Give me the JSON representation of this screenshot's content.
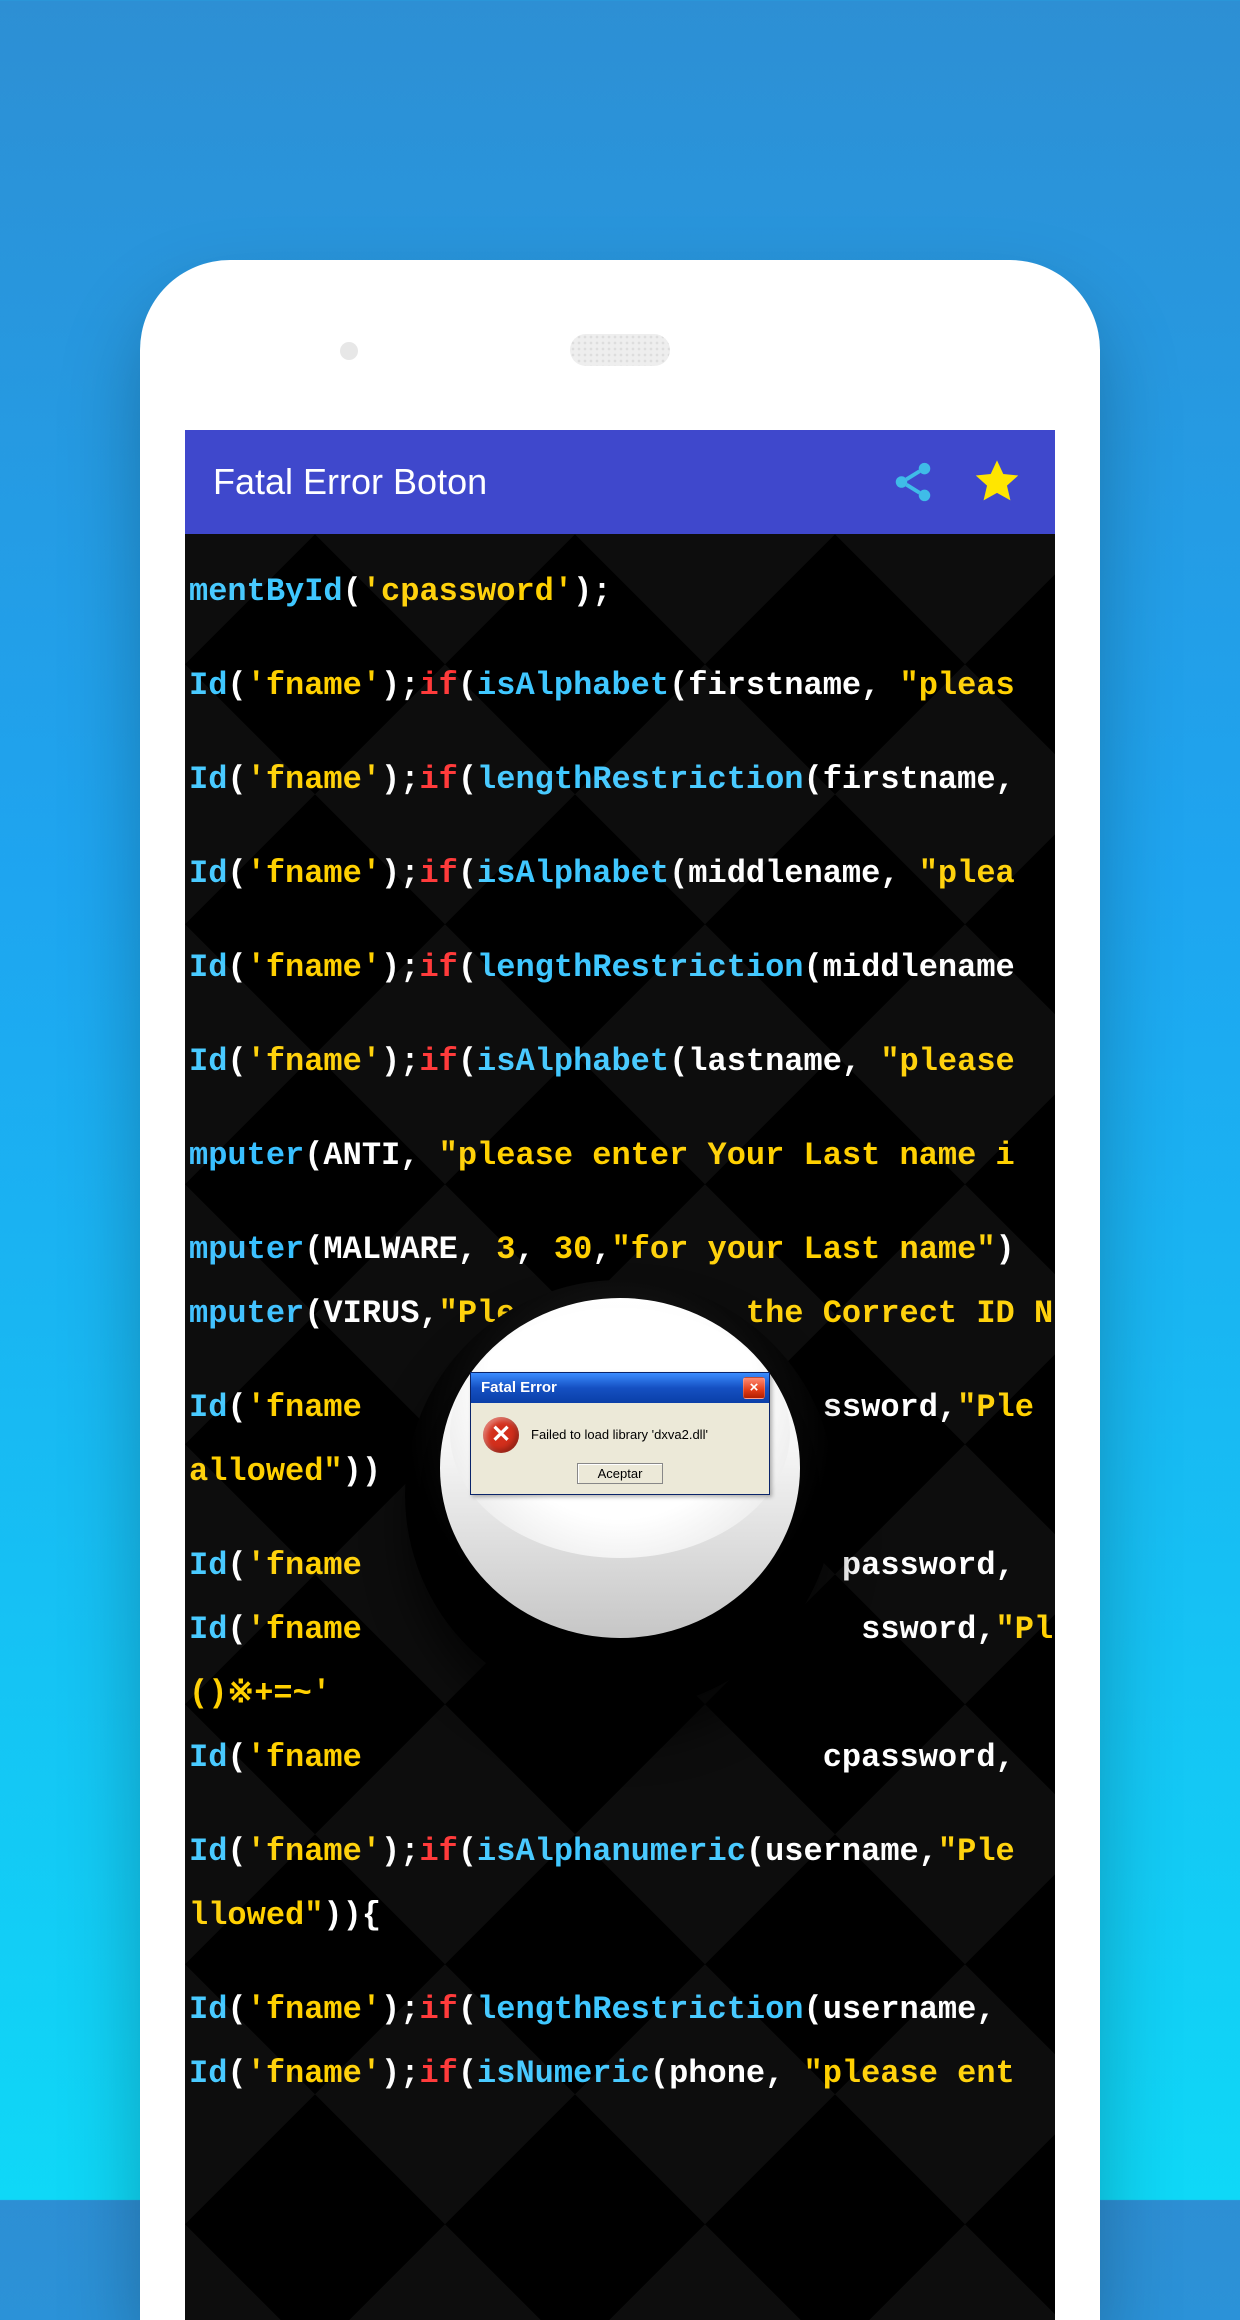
{
  "titlebar": {
    "title": "Fatal Error Boton"
  },
  "dialog": {
    "caption": "Fatal Error",
    "message": "Failed to load library 'dxva2.dll'",
    "accept": "Aceptar"
  },
  "icons": {
    "share": "share-icon",
    "star": "favorite-star-icon",
    "close": "close-icon",
    "error": "error-circle-icon"
  },
  "code_lines": [
    "mentById('cpassword');",
    "Id('fname');if(isAlphabet(firstname, \"pleas",
    "Id('fname');if(lengthRestriction(firstname,",
    "Id('fname');if(isAlphabet(middlename, \"plea",
    "Id('fname');if(lengthRestriction(middlename",
    "Id('fname');if(isAlphabet(lastname, \"please",
    "mputer(ANTI, \"please enter Your Last name i",
    "mputer(MALWARE, 3, 30,\"for your Last name\")",
    "mputer(VIRUS,\"Plea        the Correct ID N",
    "Id('fname                        ssword,\"Ple",
    "allowed\"))",
    "Id('fname                         password,",
    "Id('fname                          ssword,\"Pl",
    "()※+=~'",
    "Id('fname                        cpassword,",
    "Id('fname');if(isAlphanumeric(username,\"Ple",
    "llowed\")){",
    "Id('fname');if(lengthRestriction(username,",
    "Id('fname');if(isNumeric(phone, \"please ent"
  ]
}
